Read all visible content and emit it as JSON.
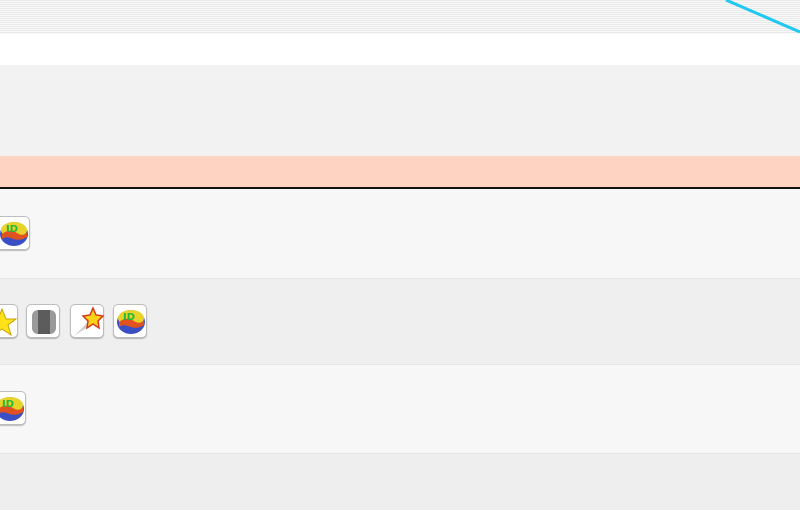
{
  "icons": {
    "row1": [
      "id-globe-icon"
    ],
    "row2": [
      "star-icon",
      "grey-tile-icon",
      "shooting-star-icon",
      "id-globe-icon"
    ],
    "row3": [
      "id-globe-icon"
    ],
    "id_glyph": "ID"
  },
  "colors": {
    "header_band": "#f2f2f2",
    "accent_line": "#1ec8f0",
    "salmon_bar": "#ffd3c1",
    "divider": "#111111",
    "row_light": "#f7f7f7",
    "row_dark": "#efefef"
  }
}
